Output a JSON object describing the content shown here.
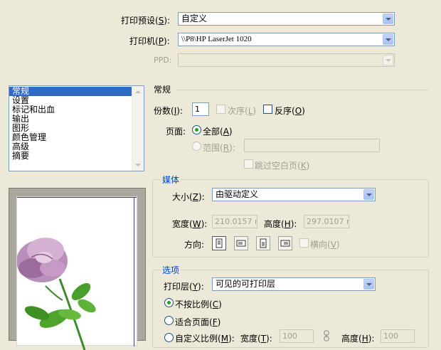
{
  "top": {
    "preset_label": "打印预设",
    "preset_key": "S",
    "preset_value": "自定义",
    "printer_label": "打印机",
    "printer_key": "P",
    "printer_value": "\\\\P8\\HP LaserJet 1020",
    "ppd_label": "PPD",
    "ppd_value": ""
  },
  "categories": {
    "items": [
      "常规",
      "设置",
      "标记和出血",
      "输出",
      "图形",
      "颜色管理",
      "高级",
      "摘要"
    ],
    "selected_index": 0
  },
  "general": {
    "title": "常规",
    "copies_label": "份数",
    "copies_key": "I",
    "copies_value": "1",
    "collate_label": "次序",
    "collate_key": "L",
    "reverse_label": "反序",
    "reverse_key": "O",
    "pages_label": "页面",
    "all_label": "全部",
    "all_key": "A",
    "range_label": "范围",
    "range_key": "R",
    "range_value": "",
    "skip_blank_label": "跳过空白页",
    "skip_blank_key": "K"
  },
  "media": {
    "title": "媒体",
    "size_label": "大小",
    "size_key": "Z",
    "size_value": "由驱动定义",
    "width_label": "宽度",
    "width_key": "W",
    "width_value": "210.0157 mi",
    "height_label": "高度",
    "height_key": "H",
    "height_value": "297.0107 mi",
    "orientation_label": "方向",
    "transverse_label": "横向",
    "transverse_key": "V"
  },
  "options": {
    "title": "选项",
    "layers_label": "打印层",
    "layers_key": "Y",
    "layers_value": "可见的可打印层",
    "no_scale_label": "不按比例",
    "no_scale_key": "C",
    "fit_label": "适合页面",
    "fit_key": "F",
    "custom_label": "自定义比例",
    "custom_key": "M",
    "scale_width_label": "宽度",
    "scale_width_key": "T",
    "scale_width_value": "100",
    "scale_height_label": "高度",
    "scale_height_key": "H",
    "scale_height_value": "100"
  },
  "colors": {
    "accent": "#0046d5",
    "selection": "#316ac5",
    "background": "#ece9d8",
    "radio_dot": "#21a121"
  }
}
